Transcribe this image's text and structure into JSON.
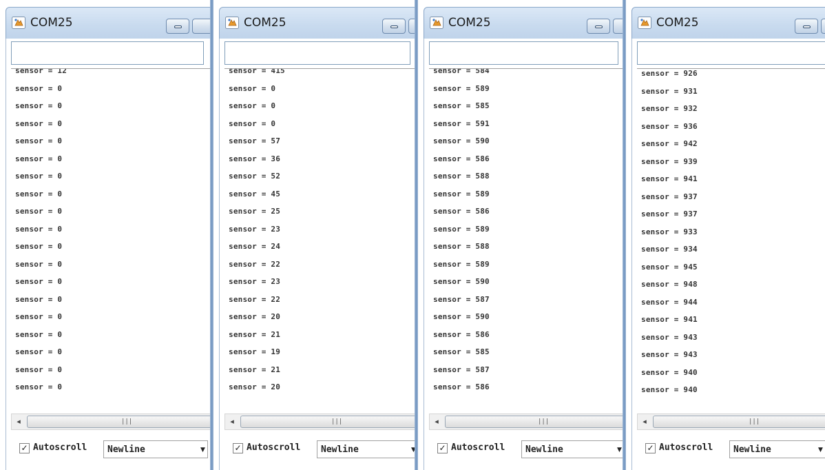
{
  "windows": [
    {
      "title": "COM25",
      "lines": [
        "sensor = 12",
        "sensor = 0",
        "sensor = 0",
        "sensor = 0",
        "sensor = 0",
        "sensor = 0",
        "sensor = 0",
        "sensor = 0",
        "sensor = 0",
        "sensor = 0",
        "sensor = 0",
        "sensor = 0",
        "sensor = 0",
        "sensor = 0",
        "sensor = 0",
        "sensor = 0",
        "sensor = 0",
        "sensor = 0",
        "sensor = 0"
      ],
      "input_value": "",
      "autoscroll_label": "Autoscroll",
      "autoscroll_checked": true,
      "line_ending": "Newline"
    },
    {
      "title": "COM25",
      "lines": [
        "sensor = 415",
        "sensor = 0",
        "sensor = 0",
        "sensor = 0",
        "sensor = 57",
        "sensor = 36",
        "sensor = 52",
        "sensor = 45",
        "sensor = 25",
        "sensor = 23",
        "sensor = 24",
        "sensor = 22",
        "sensor = 23",
        "sensor = 22",
        "sensor = 20",
        "sensor = 21",
        "sensor = 19",
        "sensor = 21",
        "sensor = 20"
      ],
      "input_value": "",
      "autoscroll_label": "Autoscroll",
      "autoscroll_checked": true,
      "line_ending": "Newline"
    },
    {
      "title": "COM25",
      "lines": [
        "sensor = 584",
        "sensor = 589",
        "sensor = 585",
        "sensor = 591",
        "sensor = 590",
        "sensor = 586",
        "sensor = 588",
        "sensor = 589",
        "sensor = 586",
        "sensor = 589",
        "sensor = 588",
        "sensor = 589",
        "sensor = 590",
        "sensor = 587",
        "sensor = 590",
        "sensor = 586",
        "sensor = 585",
        "sensor = 587",
        "sensor = 586"
      ],
      "input_value": "",
      "autoscroll_label": "Autoscroll",
      "autoscroll_checked": true,
      "line_ending": "Newline"
    },
    {
      "title": "COM25",
      "lines": [
        "sensor = 926",
        "sensor = 931",
        "sensor = 932",
        "sensor = 936",
        "sensor = 942",
        "sensor = 939",
        "sensor = 941",
        "sensor = 937",
        "sensor = 937",
        "sensor = 933",
        "sensor = 934",
        "sensor = 945",
        "sensor = 948",
        "sensor = 944",
        "sensor = 941",
        "sensor = 943",
        "sensor = 943",
        "sensor = 940",
        "sensor = 940"
      ],
      "input_value": "",
      "autoscroll_label": "Autoscroll",
      "autoscroll_checked": true,
      "line_ending": "Newline"
    }
  ],
  "icons": {
    "app": "arduino-app-icon",
    "minimize": "minimize-icon",
    "scroll_left": "arrow-left-icon",
    "dropdown": "chevron-down-icon",
    "check": "checkmark-icon",
    "grip": "scroll-grip-icon"
  },
  "colors": {
    "titlebar": "#c9dbef",
    "separator": "#6f93bf",
    "text": "#333333"
  }
}
